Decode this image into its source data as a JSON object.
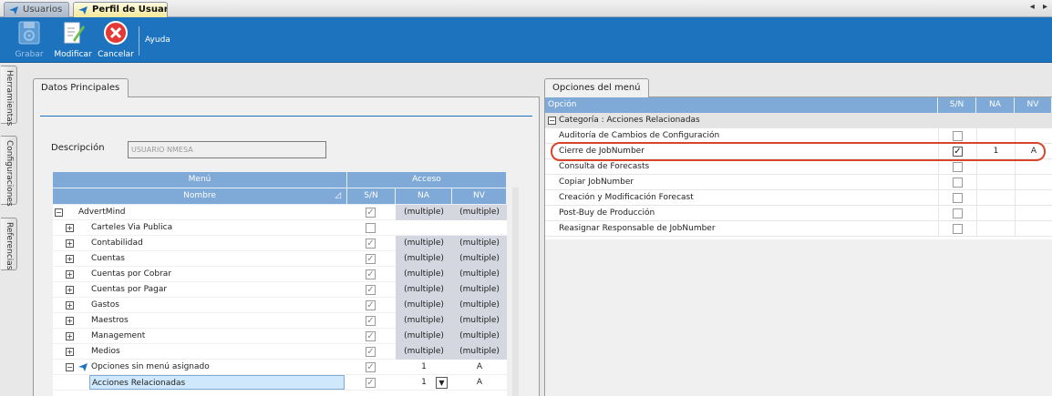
{
  "tabs": [
    {
      "label": "Usuarios",
      "active": false
    },
    {
      "label": "Perfil de Usuario",
      "active": true
    }
  ],
  "nav_arrows": "◂ ▸",
  "toolbar": {
    "grabar": "Grabar",
    "modificar": "Modificar",
    "cancelar": "Cancelar",
    "ayuda": "Ayuda"
  },
  "side_tabs": [
    "Herramientas",
    "Configuraciones",
    "Referencias"
  ],
  "left_panel": {
    "tab_label": "Datos Principales",
    "descripcion_label": "Descripción",
    "descripcion_value": "USUARIO NMESA",
    "grid": {
      "group_menu": "Menú",
      "group_acceso": "Acceso",
      "col_nombre": "Nombre",
      "col_sn": "S/N",
      "col_na": "NA",
      "col_nv": "NV",
      "rows": [
        {
          "name": "AdvertMind",
          "expander": "−",
          "checked": true,
          "na": "(multiple)",
          "nv": "(multiple)"
        },
        {
          "name": "Carteles Via Publica",
          "expander": "+",
          "checked": false,
          "na": "",
          "nv": ""
        },
        {
          "name": "Contabilidad",
          "expander": "+",
          "checked": true,
          "na": "(multiple)",
          "nv": "(multiple)"
        },
        {
          "name": "Cuentas",
          "expander": "+",
          "checked": true,
          "na": "(multiple)",
          "nv": "(multiple)"
        },
        {
          "name": "Cuentas por Cobrar",
          "expander": "+",
          "checked": true,
          "na": "(multiple)",
          "nv": "(multiple)"
        },
        {
          "name": "Cuentas por Pagar",
          "expander": "+",
          "checked": true,
          "na": "(multiple)",
          "nv": "(multiple)"
        },
        {
          "name": "Gastos",
          "expander": "+",
          "checked": true,
          "na": "(multiple)",
          "nv": "(multiple)"
        },
        {
          "name": "Maestros",
          "expander": "+",
          "checked": true,
          "na": "(multiple)",
          "nv": "(multiple)"
        },
        {
          "name": "Management",
          "expander": "+",
          "checked": true,
          "na": "(multiple)",
          "nv": "(multiple)"
        },
        {
          "name": "Medios",
          "expander": "+",
          "checked": true,
          "na": "(multiple)",
          "nv": "(multiple)"
        },
        {
          "name": "Opciones sin menú asignado",
          "expander": "−",
          "checked": true,
          "na": "1",
          "nv": "A"
        },
        {
          "name": "Acciones Relacionadas",
          "expander": "",
          "checked": true,
          "na": "1",
          "nv": "A",
          "selected": true
        }
      ]
    }
  },
  "right_panel": {
    "tab_label": "Opciones del menú",
    "col_opcion": "Opción",
    "col_sn": "S/N",
    "col_na": "NA",
    "col_nv": "NV",
    "category": "Categoría : Acciones Relacionadas",
    "rows": [
      {
        "name": "Auditoría de Cambios de Configuración",
        "checked": false,
        "na": "",
        "nv": ""
      },
      {
        "name": "Cierre de JobNumber",
        "checked": true,
        "na": "1",
        "nv": "A",
        "highlighted": true
      },
      {
        "name": "Consulta de Forecasts",
        "checked": false,
        "na": "",
        "nv": ""
      },
      {
        "name": "Copiar JobNumber",
        "checked": false,
        "na": "",
        "nv": ""
      },
      {
        "name": "Creación y Modificación Forecast",
        "checked": false,
        "na": "",
        "nv": ""
      },
      {
        "name": "Post-Buy de Producción",
        "checked": false,
        "na": "",
        "nv": ""
      },
      {
        "name": "Reasignar Responsable de JobNumber",
        "checked": false,
        "na": "",
        "nv": ""
      }
    ]
  },
  "colors": {
    "toolbar": "#1e73be",
    "grid_header": "#7fa9d6",
    "highlight": "#d9442b",
    "selected_row": "#cfe8fb"
  }
}
